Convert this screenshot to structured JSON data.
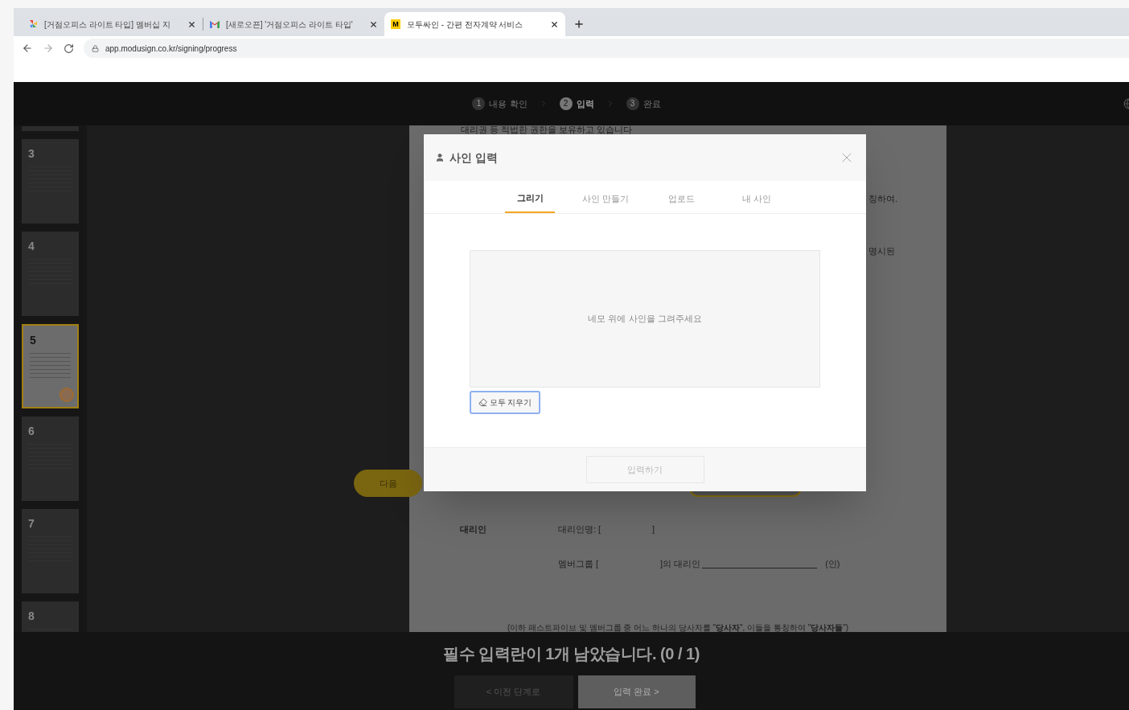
{
  "browser": {
    "tabs": [
      {
        "title": "[거점오피스 라이트 타입] 멤버십 지",
        "kind": "pinwheel",
        "selected": false
      },
      {
        "title": "[새로오픈] '거점오피스 라이트 타입'",
        "kind": "mail",
        "selected": false
      },
      {
        "title": "모두싸인 - 간편 전자계약 서비스",
        "kind": "letter",
        "favicon_text": "M",
        "selected": true
      }
    ],
    "url": "app.modusign.co.kr/signing/progress"
  },
  "steps": [
    {
      "number": "1",
      "label": "내용 확인",
      "selected": false
    },
    {
      "number": "2",
      "label": "입력",
      "selected": true
    },
    {
      "number": "3",
      "label": "완료",
      "selected": false
    }
  ],
  "thumbnails": [
    {
      "number": "3",
      "selected": false
    },
    {
      "number": "4",
      "selected": false
    },
    {
      "number": "5",
      "selected": true
    },
    {
      "number": "6",
      "selected": false
    },
    {
      "number": "7",
      "selected": false
    },
    {
      "number": "8",
      "selected": false
    }
  ],
  "document": {
    "top_line": "대리권 등 적법한 권한을 보유하고 있습니다",
    "side_fragments": [
      "칭하여.",
      "명시된"
    ],
    "agent_label": "대리인",
    "agent_name": "대리인명: [",
    "agent_name_end": "]",
    "member_group": "멤버그룹 [",
    "agent_of": "]의 대리인",
    "seal": "(인)",
    "definition": "(이하 패스트파이브 및 멤버그룹 중 어느 하나의 당사자를 \"**당사자**\", 이들을 통칭하여 \"**당사자들**\")"
  },
  "next_button": "다음",
  "modal": {
    "title": "사인 입력",
    "tabs": [
      {
        "label": "그리기",
        "selected": true
      },
      {
        "label": "사인 만들기",
        "selected": false
      },
      {
        "label": "업로드",
        "selected": false
      },
      {
        "label": "내 사인",
        "selected": false
      }
    ],
    "canvas_placeholder": "네모 위에 사인을 그려주세요",
    "clear_button": "모두 지우기",
    "submit_button": {
      "label": "입력하기",
      "disabled": true
    }
  },
  "footer": {
    "message": "필수 입력란이 1개 남았습니다. (0 / 1)",
    "prev_button": "< 이전 단계로",
    "complete_button": {
      "label": "입력 완료 >",
      "disabled": true
    }
  }
}
